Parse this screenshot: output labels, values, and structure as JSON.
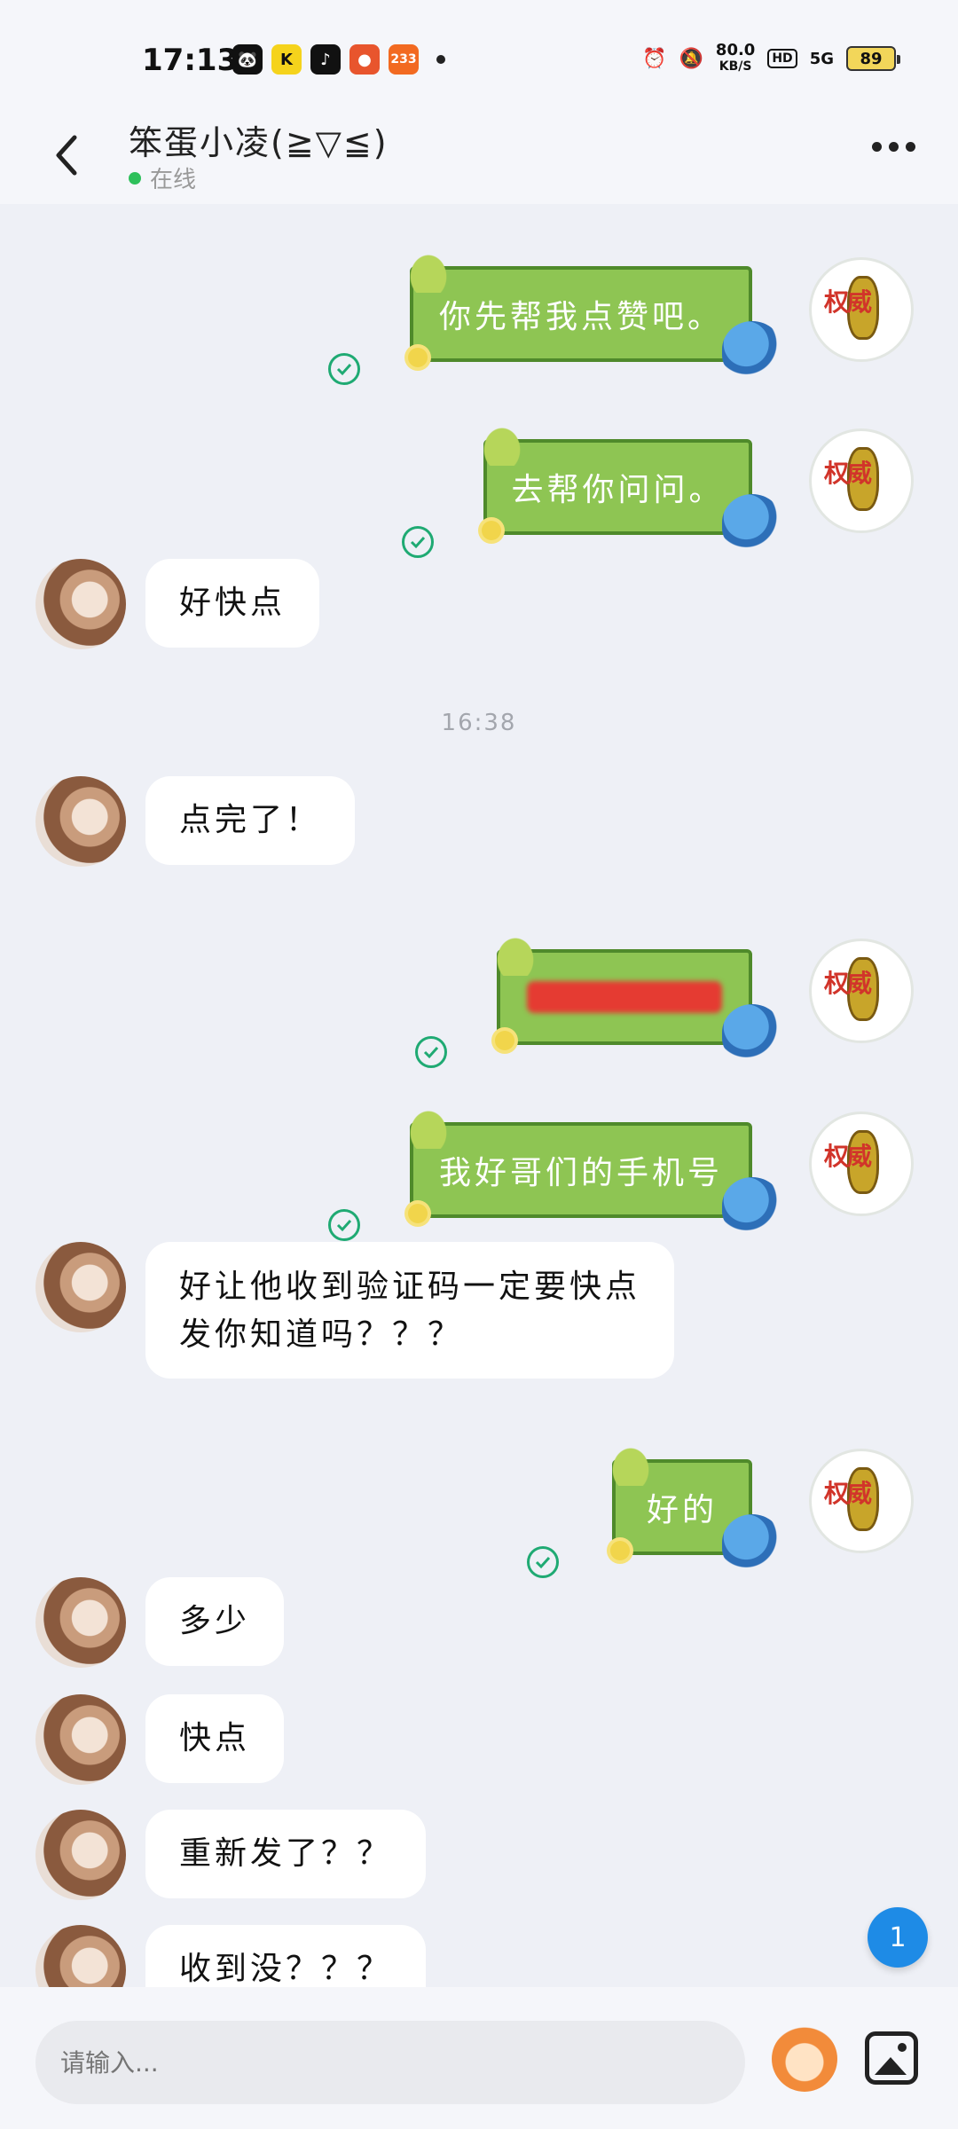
{
  "status_bar": {
    "time": "17:13",
    "apps": [
      "🐼",
      "K",
      "♪",
      "●",
      "233"
    ],
    "speed_value": "80.0",
    "speed_unit": "KB/S",
    "hd": "HD",
    "network": "5G",
    "battery": "89"
  },
  "header": {
    "contact_name": "笨蛋小凌(≧▽≦)",
    "status": "在线"
  },
  "messages": [
    {
      "side": "right",
      "text": "你先帮我点赞吧。"
    },
    {
      "side": "right",
      "text": "去帮你问问。"
    },
    {
      "side": "left",
      "text": "好快点"
    },
    {
      "time": "16:38"
    },
    {
      "side": "left",
      "text": "点完了！"
    },
    {
      "side": "right",
      "text": ""
    },
    {
      "side": "right",
      "text": "我好哥们的手机号"
    },
    {
      "side": "left",
      "text": "好让他收到验证码一定要快点",
      "text2": "发你知道吗？？？"
    },
    {
      "side": "right",
      "text": "好的"
    },
    {
      "side": "left",
      "text": "多少"
    },
    {
      "side": "left",
      "text": "快点"
    },
    {
      "side": "left",
      "text": "重新发了？？"
    },
    {
      "side": "left",
      "text": "收到没？？？"
    }
  ],
  "avatar_right_text": "权威",
  "unread_badge": "1",
  "input": {
    "placeholder": "请输入..."
  },
  "colors": {
    "accent": "#1e8be6",
    "bubble_green": "#8ec553",
    "check": "#1faa73",
    "online": "#2ec05b"
  }
}
